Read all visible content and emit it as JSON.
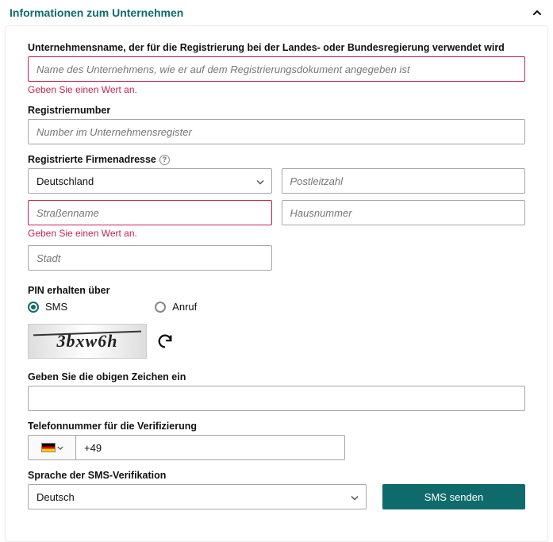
{
  "section": {
    "title": "Informationen zum Unternehmen"
  },
  "company_name": {
    "label": "Unternehmensname, der für die Registrierung bei der Landes- oder Bundesregierung verwendet wird",
    "placeholder": "Name des Unternehmens, wie er auf dem Registrierungsdokument angegeben ist",
    "error": "Geben Sie einen Wert an."
  },
  "reg_number": {
    "label": "Registriernumber",
    "placeholder": "Number im Unternehmensregister"
  },
  "address": {
    "label": "Registrierte Firmenadresse",
    "country": "Deutschland",
    "zip_placeholder": "Postleitzahl",
    "street_placeholder": "Straßenname",
    "street_error": "Geben Sie einen Wert an.",
    "house_placeholder": "Hausnummer",
    "city_placeholder": "Stadt"
  },
  "pin": {
    "label": "PIN erhalten über",
    "sms": "SMS",
    "call": "Anruf"
  },
  "captcha": {
    "text": "3bxw6h",
    "label": "Geben Sie die obigen Zeichen ein"
  },
  "phone": {
    "label": "Telefonnummer für die Verifizierung",
    "prefix": "+49"
  },
  "language": {
    "label": "Sprache der SMS-Verifikation",
    "value": "Deutsch"
  },
  "button": {
    "send": "SMS senden"
  }
}
